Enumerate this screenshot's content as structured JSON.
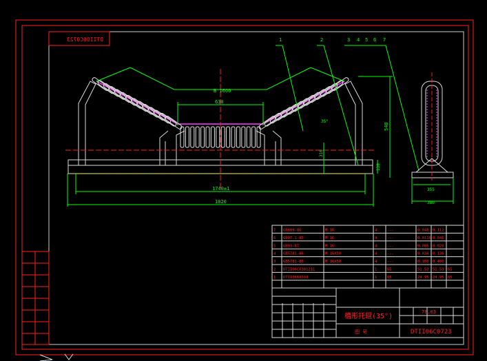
{
  "drawing": {
    "number": "DTII06C0723",
    "number_mirrored": "DTII06C0723",
    "balloons": [
      "1",
      "2",
      "3",
      "4",
      "5",
      "6",
      "7"
    ]
  },
  "dims": {
    "belt_width": "B 1600",
    "center_width": "630",
    "angle": "35°",
    "overall_height": "548",
    "side_height": "316",
    "small_height": "130",
    "inner_length": "1740±1",
    "overall_length": "1820",
    "side_width_inner": "355",
    "side_width_outer": "380"
  },
  "parts_list": [
    {
      "no": "7",
      "code": "GB889-86",
      "spec": "M 16",
      "qty": "4",
      "mat": "---",
      "unit": "0.048",
      "total": "0.112",
      "note": ""
    },
    {
      "no": "6",
      "code": "GB97.1-85",
      "spec": "M 16",
      "qty": "4",
      "mat": "---",
      "unit": "0.0116",
      "total": "0.046",
      "note": ""
    },
    {
      "no": "5",
      "code": "GB93-87",
      "spec": "M 16",
      "qty": "4",
      "mat": "---",
      "unit": "0.005",
      "total": "0.020",
      "note": ""
    },
    {
      "no": "4",
      "code": "GB5781-86",
      "spec": "M 16X50",
      "qty": "4",
      "mat": "---",
      "unit": "0.034",
      "total": "0.136",
      "note": ""
    },
    {
      "no": "3",
      "code": "GB5781-86",
      "spec": "M 16X50",
      "qty": "4",
      "mat": "---",
      "unit": "0.100",
      "total": "0.400",
      "note": ""
    },
    {
      "no": "2",
      "code": "DTII06C0301211",
      "spec": "",
      "qty": "1",
      "mat": "65",
      "unit": "51.53",
      "total": "51.53",
      "note": "65"
    },
    {
      "no": "1",
      "code": "DTII06B8308",
      "spec": "",
      "qty": "1",
      "mat": "65",
      "unit": "24.95",
      "total": "24.95",
      "note": "65"
    }
  ],
  "parts_header": [
    "",
    "",
    "",
    "",
    "",
    "",
    ""
  ],
  "title_block": {
    "part_name": "槽形托辊(35°)",
    "weight": "78.03",
    "drawing_no": "DTII06C0723",
    "remark": "图 号"
  },
  "left_strip": [
    "",
    "",
    "",
    "",
    "",
    "",
    "",
    ""
  ]
}
